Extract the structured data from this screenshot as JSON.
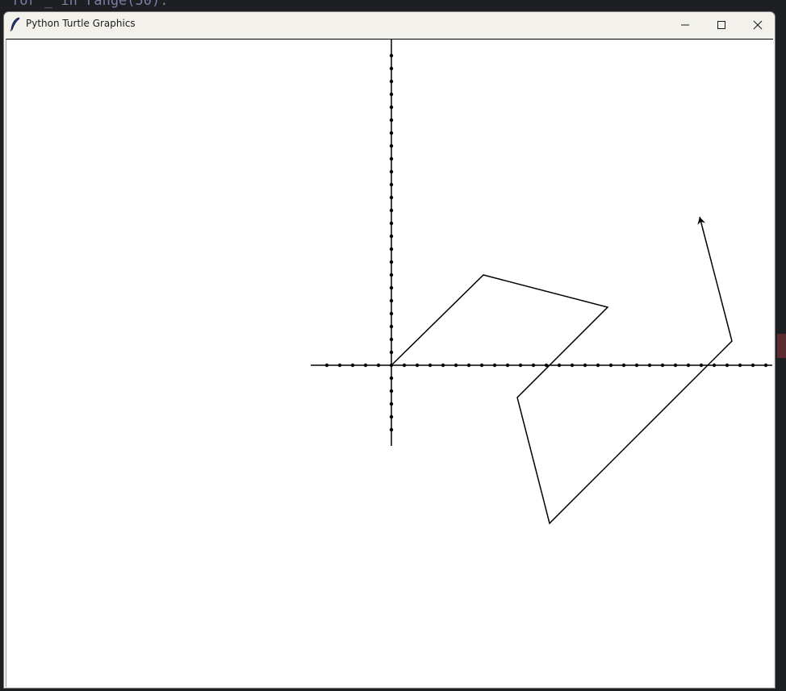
{
  "window": {
    "title": "Python Turtle Graphics",
    "minimize_icon": "minimize-icon",
    "maximize_icon": "maximize-icon",
    "close_icon": "close-icon",
    "app_icon": "feather-icon"
  },
  "canvas": {
    "background": "#ffffff",
    "stroke_color": "#000000",
    "axis_tick_spacing": 16,
    "x_axis": {
      "from": -100,
      "to": 472
    },
    "y_axis": {
      "from": -100,
      "to": 404
    },
    "path_points": [
      [
        0,
        0
      ],
      [
        114,
        112
      ],
      [
        268,
        72
      ],
      [
        156,
        -40
      ],
      [
        196,
        -196
      ],
      [
        422,
        30
      ],
      [
        382,
        184
      ]
    ],
    "turtle_heading_deg": 104
  }
}
